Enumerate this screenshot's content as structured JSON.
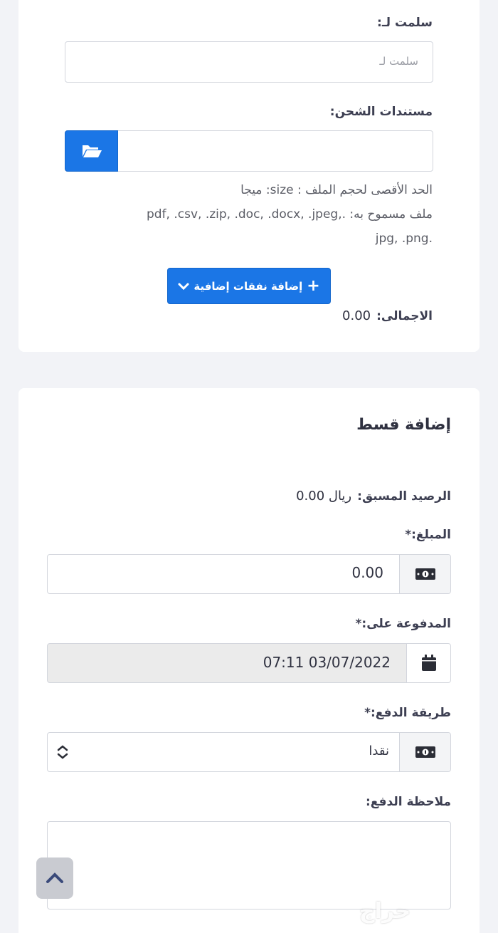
{
  "received_by": {
    "label": "سلمت لـ:",
    "placeholder": "سلمت لـ"
  },
  "shipping_docs": {
    "label": "مستندات الشحن:",
    "icon": "folder-open-icon",
    "max_size_text": "الحد الأقصى لحجم الملف : size: ميجا",
    "allowed_line1": "ملف مسموح به: .,pdf, .csv, .zip, .doc, .docx, .jpeg",
    "allowed_line2": ".jpg, .png"
  },
  "add_expenses_button": "إضافة نفقات إضافية",
  "total": {
    "label": "الاجمالى:",
    "value": "0.00"
  },
  "installment": {
    "title": "إضافة قسط",
    "prepaid_label": "الرصيد المسبق:",
    "prepaid_value": "ريال 0.00",
    "amount_label": "المبلغ:*",
    "amount_value": "0.00",
    "paid_on_label": "المدفوعة على:*",
    "paid_on_value": "07:11 03/07/2022",
    "method_label": "طريقة الدفع:*",
    "method_value": "نقدا",
    "note_label": "ملاحظة الدفع:",
    "note_value": ""
  },
  "watermark": "حراج",
  "colors": {
    "primary": "#1b76e6",
    "background": "#f2f3f7",
    "card": "#ffffff"
  }
}
